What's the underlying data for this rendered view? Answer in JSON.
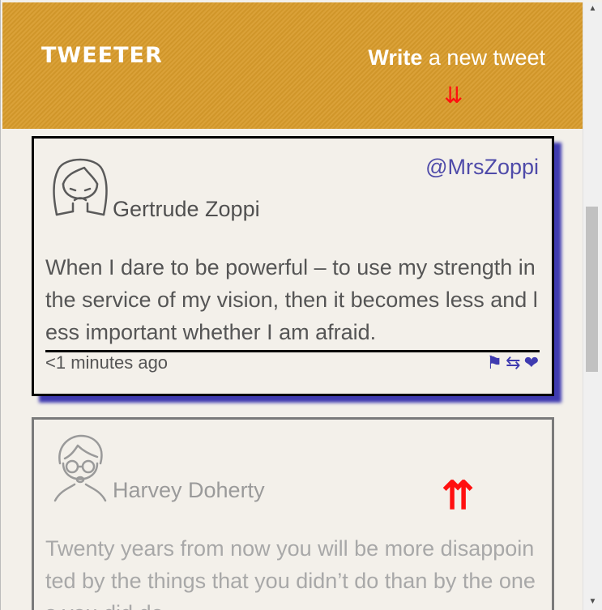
{
  "header": {
    "logo": "TWEETER",
    "write_bold": "Write",
    "write_rest": " a new tweet",
    "down_arrows": "⇊"
  },
  "tweets": [
    {
      "name": "Gertrude Zoppi",
      "handle": "@MrsZoppi",
      "text": "When I dare to be powerful – to use my strength in the service of my vision, then it becomes less and less important whether I am afraid.",
      "time": "<1 minutes ago",
      "actions": {
        "flag": "⚑",
        "retweet": "⇆",
        "like": "❤"
      }
    },
    {
      "name": "Harvey Doherty",
      "text": "Twenty years from now you will be more disappointed by the things that you didn’t do than by the ones you did do.",
      "up_arrows": "⇈"
    }
  ],
  "scrollbar": {
    "up": "▲",
    "down": "▼"
  }
}
